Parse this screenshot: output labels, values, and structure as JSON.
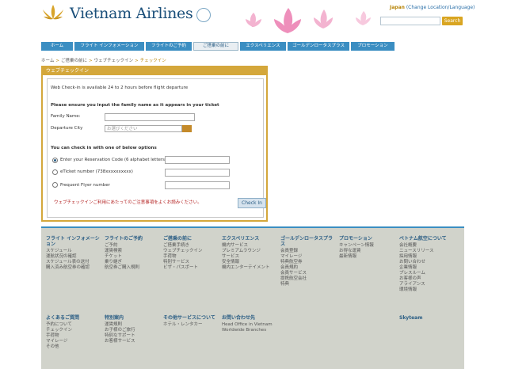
{
  "header": {
    "brand": "Vietnam Airlines",
    "language_current": "Japan",
    "language_change": "(Change Location/Language)",
    "search_placeholder": "",
    "search_label": "Search"
  },
  "nav": [
    {
      "label": "ホーム",
      "w": 40
    },
    {
      "label": "フライト インフォメーション",
      "w": 88
    },
    {
      "label": "フライトのご予約",
      "w": 58
    },
    {
      "label": "ご搭乗の前に",
      "w": 55,
      "active": true
    },
    {
      "label": "エクスペリエンス",
      "w": 58
    },
    {
      "label": "ゴールデンロータスプラス",
      "w": 78
    },
    {
      "label": "プロモーション",
      "w": 55
    }
  ],
  "breadcrumb": {
    "items": [
      "ホーム",
      "ご搭乗の前に",
      "ウェブチェックイン"
    ],
    "current": "チェックイン"
  },
  "panel": {
    "title": "ウェブチェックイン",
    "intro": "Web Check-in is available 24 to 2 hours before flight departure",
    "instruction": "Please ensure you input the family name as it appears in your ticket",
    "family_name_label": "Family Name:",
    "departure_label": "Departure City",
    "departure_placeholder": "お選びください",
    "options_label": "You can check in with one of below options",
    "opt1": "Enter your Reservation Code (6 alphabet letters)",
    "opt2": "eTicket number (738xxxxxxxxxx)",
    "opt3": "Frequent Flyer number",
    "notice": "ウェブチェックインご利用にあたってのご注意事項をよくお読みください。",
    "checkin_label": "Check In"
  },
  "footer": {
    "cols": [
      {
        "h": "フライト インフォメーション",
        "items": [
          "スケジュール",
          "運航状況の確認",
          "スケジュール表の送付",
          "購入済み航空券の確認"
        ]
      },
      {
        "h": "フライトのご予約",
        "items": [
          "ご予約",
          "運賃検索",
          "チケット",
          "乗り継ぎ",
          "航空券ご購入規則"
        ]
      },
      {
        "h": "ご搭乗の前に",
        "items": [
          "ご搭乗手続き",
          "ウェブチェックイン",
          "手荷物",
          "特別サービス",
          "ビザ・パスポート"
        ]
      },
      {
        "h": "エクスペリエンス",
        "items": [
          "機内サービス",
          "プレミアムラウンジ",
          "サービス",
          "安全情報",
          "機内エンターテイメント"
        ]
      },
      {
        "h": "ゴールデンロータスプラス",
        "items": [
          "会員登録",
          "マイレージ",
          "特典航空券",
          "会員規約",
          "会員サービス",
          "提携航空会社",
          "特典"
        ]
      },
      {
        "h": "プロモーション",
        "items": [
          "キャンペーン情報",
          "お得な運賃",
          "最新情報"
        ]
      },
      {
        "h": "ベトナム航空について",
        "items": [
          "会社概要",
          "ニュースリリース",
          "採用情報",
          "お問い合わせ",
          "企業情報",
          "プレスルーム",
          "お客様の声",
          "アライアンス",
          "環境情報"
        ]
      }
    ],
    "cols2": [
      {
        "h": "よくあるご質問",
        "items": [
          "予約について",
          "チェックイン",
          "手荷物",
          "マイレージ",
          "その他"
        ]
      },
      {
        "h": "特別案内",
        "items": [
          "運賃規則",
          "お子様のご旅行",
          "特別なサポート",
          "お客様サービス"
        ]
      },
      {
        "h": "その他サービスについて",
        "items": [
          "ホテル・レンタカー"
        ]
      },
      {
        "h": "お問い合わせ先",
        "items": [
          "Head Office in Vietnam",
          "Worldwide Branches"
        ]
      },
      {
        "h": "Skyteam",
        "items": []
      }
    ]
  }
}
